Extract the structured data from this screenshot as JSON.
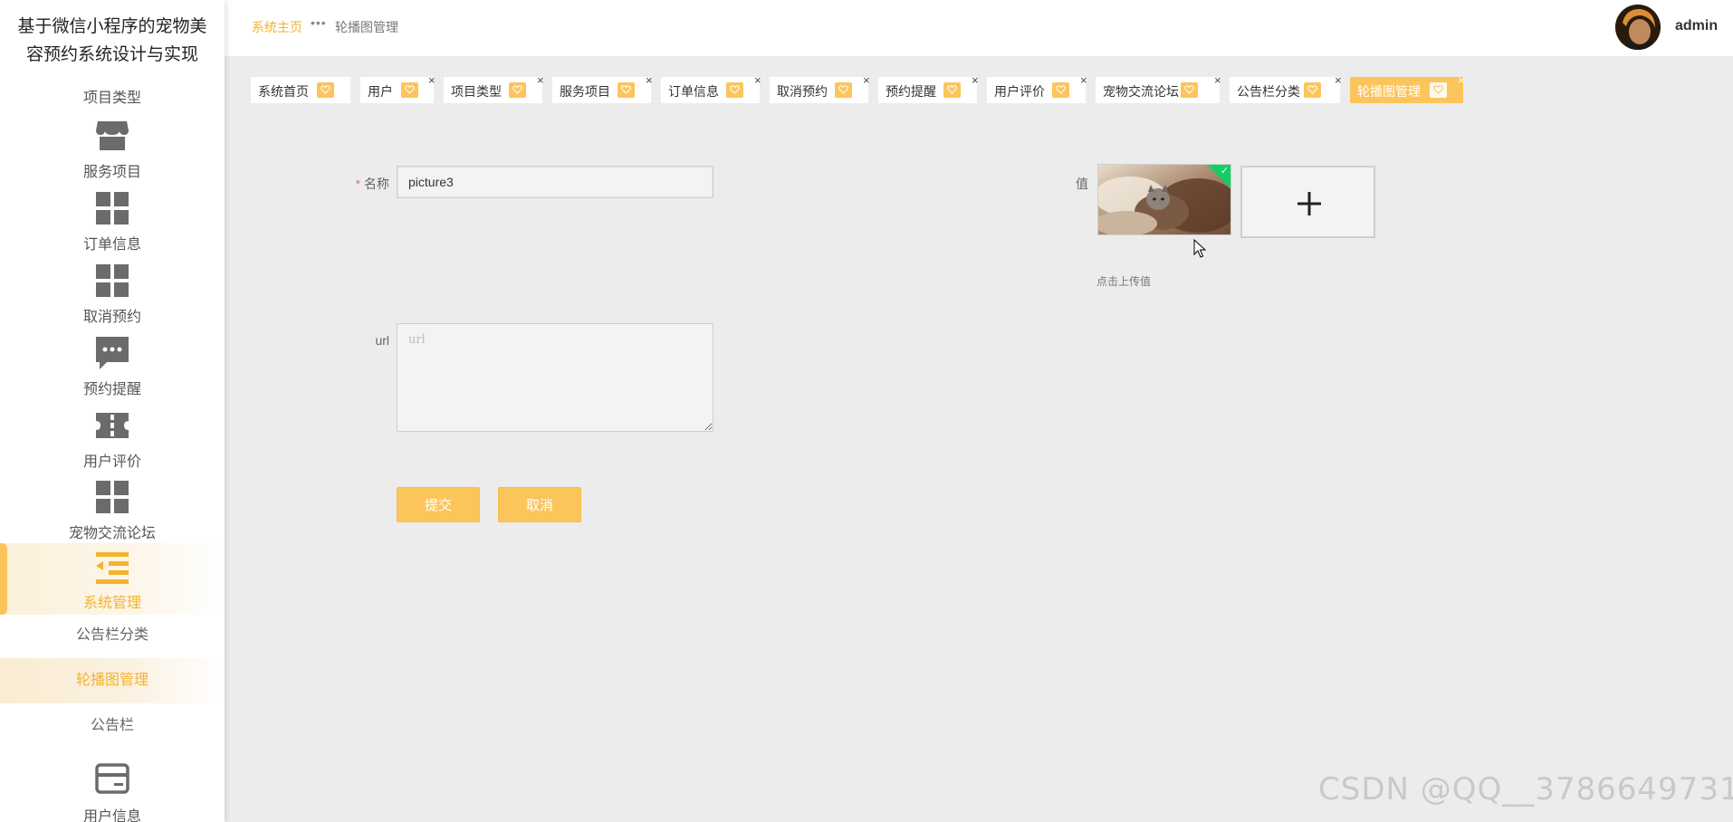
{
  "app": {
    "title_line1": "基于微信小程序的宠物美",
    "title_line2": "容预约系统设计与实现"
  },
  "sidebar": {
    "cut_item_label": "项目类型",
    "items": [
      {
        "label": "服务项目",
        "icon": "shop-icon"
      },
      {
        "label": "订单信息",
        "icon": "grid-icon"
      },
      {
        "label": "取消预约",
        "icon": "grid-icon"
      },
      {
        "label": "预约提醒",
        "icon": "chat-icon"
      },
      {
        "label": "用户评价",
        "icon": "ticket-icon"
      },
      {
        "label": "宠物交流论坛",
        "icon": "grid-icon"
      },
      {
        "label": "系统管理",
        "icon": "list-indent-icon",
        "active": true
      }
    ],
    "subitems": [
      {
        "label": "公告栏分类"
      },
      {
        "label": "轮播图管理",
        "active": true
      },
      {
        "label": "公告栏"
      }
    ],
    "bottom_item": {
      "label": "用户信息",
      "icon": "card-icon"
    }
  },
  "header": {
    "breadcrumb_home": "系统主页",
    "breadcrumb_sep": "•••",
    "breadcrumb_current": "轮播图管理",
    "username": "admin"
  },
  "tabs": [
    {
      "label": "系统首页",
      "closable": false
    },
    {
      "label": "用户",
      "closable": true
    },
    {
      "label": "项目类型",
      "closable": true
    },
    {
      "label": "服务项目",
      "closable": true
    },
    {
      "label": "订单信息",
      "closable": true
    },
    {
      "label": "取消预约",
      "closable": true
    },
    {
      "label": "预约提醒",
      "closable": true
    },
    {
      "label": "用户评价",
      "closable": true
    },
    {
      "label": "宠物交流论坛",
      "closable": true
    },
    {
      "label": "公告栏分类",
      "closable": true
    },
    {
      "label": "轮播图管理",
      "closable": true,
      "active": true
    }
  ],
  "form": {
    "name_label_required": "*",
    "name_label": "名称",
    "name_value": "picture3",
    "url_label": "url",
    "url_placeholder": "url",
    "value_label": "值",
    "upload_hint": "点击上传值",
    "submit_label": "提交",
    "cancel_label": "取消"
  },
  "watermark": "CSDN @QQ__3786649731",
  "colors": {
    "accent": "#fcc55c",
    "accent_text": "#f5b22c",
    "success": "#13ce66",
    "background": "#ececec"
  }
}
